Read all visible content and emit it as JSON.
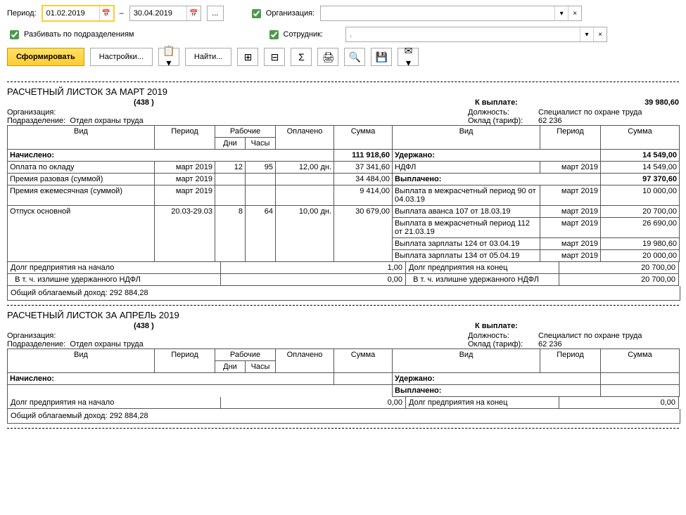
{
  "toolbar": {
    "period_label": "Период:",
    "date_from": "01.02.2019",
    "date_to": "30.04.2019",
    "dots": "...",
    "org_label": "Организация:",
    "split_label": "Разбивать по подразделениям",
    "emp_label": "Сотрудник:",
    "emp_placeholder": "           ,",
    "generate": "Сформировать",
    "settings": "Настройки...",
    "find": "Найти..."
  },
  "r1": {
    "title": "РАСЧЕТНЫЙ ЛИСТОК ЗА МАРТ 2019",
    "sub": "(438       )",
    "org_label": "Организация:",
    "dept_label": "Подразделение:",
    "dept": "Отдел охраны труда",
    "pay_label": "К выплате:",
    "pay_value": "39 980,60",
    "pos_label": "Должность:",
    "pos": "Специалист по охране труда",
    "sal_label": "Оклад (тариф):",
    "sal": "62 236",
    "h_vid": "Вид",
    "h_period": "Период",
    "h_days": "Дни",
    "h_hours": "Часы",
    "h_paid": "Оплачено",
    "h_sum": "Сумма",
    "h_work": "Рабочие",
    "accrued": {
      "label": "Начислено:",
      "sum": "111 918,60"
    },
    "held": {
      "label": "Удержано:",
      "sum": "14 549,00"
    },
    "paid_lbl": {
      "label": "Выплачено:",
      "sum": "97 370,60"
    },
    "rows_left": [
      {
        "name": "Оплата по окладу",
        "period": "март 2019",
        "days": "12",
        "hours": "95",
        "paid": "12,00 дн.",
        "sum": "37 341,60"
      },
      {
        "name": "Премия разовая (суммой)",
        "period": "март 2019",
        "days": "",
        "hours": "",
        "paid": "",
        "sum": "34 484,00"
      },
      {
        "name": "Премия ежемесячная (суммой)",
        "period": "март 2019",
        "days": "",
        "hours": "",
        "paid": "",
        "sum": "9 414,00"
      },
      {
        "name": "Отпуск основной",
        "period": "20.03-29.03",
        "days": "8",
        "hours": "64",
        "paid": "10,00 дн.",
        "sum": "30 679,00"
      }
    ],
    "rows_right": [
      {
        "name": "НДФЛ",
        "period": "март 2019",
        "sum": "14 549,00"
      },
      {
        "name": "Выплата в межрасчетный период 90 от 04.03.19",
        "period": "март 2019",
        "sum": "10 000,00"
      },
      {
        "name": "Выплата аванса 107 от 18.03.19",
        "period": "март 2019",
        "sum": "20 700,00"
      },
      {
        "name": "Выплата в межрасчетный период 112 от 21.03.19",
        "period": "март 2019",
        "sum": "26 690,00"
      },
      {
        "name": "Выплата зарплаты 124 от 03.04.19",
        "period": "март 2019",
        "sum": "19 980,60"
      },
      {
        "name": "Выплата зарплаты 134 от 05.04.19",
        "period": "март 2019",
        "sum": "20 000,00"
      }
    ],
    "debt_start": "Долг предприятия на начало",
    "debt_start_v": "1,00",
    "debt_end": "Долг предприятия на конец",
    "debt_end_v": "20 700,00",
    "overheld": "В т. ч. излишне удержанного НДФЛ",
    "overheld_v1": "0,00",
    "overheld_v2": "20 700,00",
    "taxable": "Общий облагаемый доход: 292 884,28"
  },
  "r2": {
    "title": "РАСЧЕТНЫЙ ЛИСТОК ЗА АПРЕЛЬ 2019",
    "sub": "(438       )",
    "org_label": "Организация:",
    "dept_label": "Подразделение:",
    "dept": "Отдел охраны труда",
    "pay_label": "К выплате:",
    "pos_label": "Должность:",
    "pos": "Специалист по охране труда",
    "sal_label": "Оклад (тариф):",
    "sal": "62 236",
    "accrued": "Начислено:",
    "held": "Удержано:",
    "paid": "Выплачено:",
    "debt_start": "Долг предприятия на начало",
    "debt_start_v": "0,00",
    "debt_end": "Долг предприятия на конец",
    "debt_end_v": "0,00",
    "taxable": "Общий облагаемый доход: 292 884,28"
  }
}
